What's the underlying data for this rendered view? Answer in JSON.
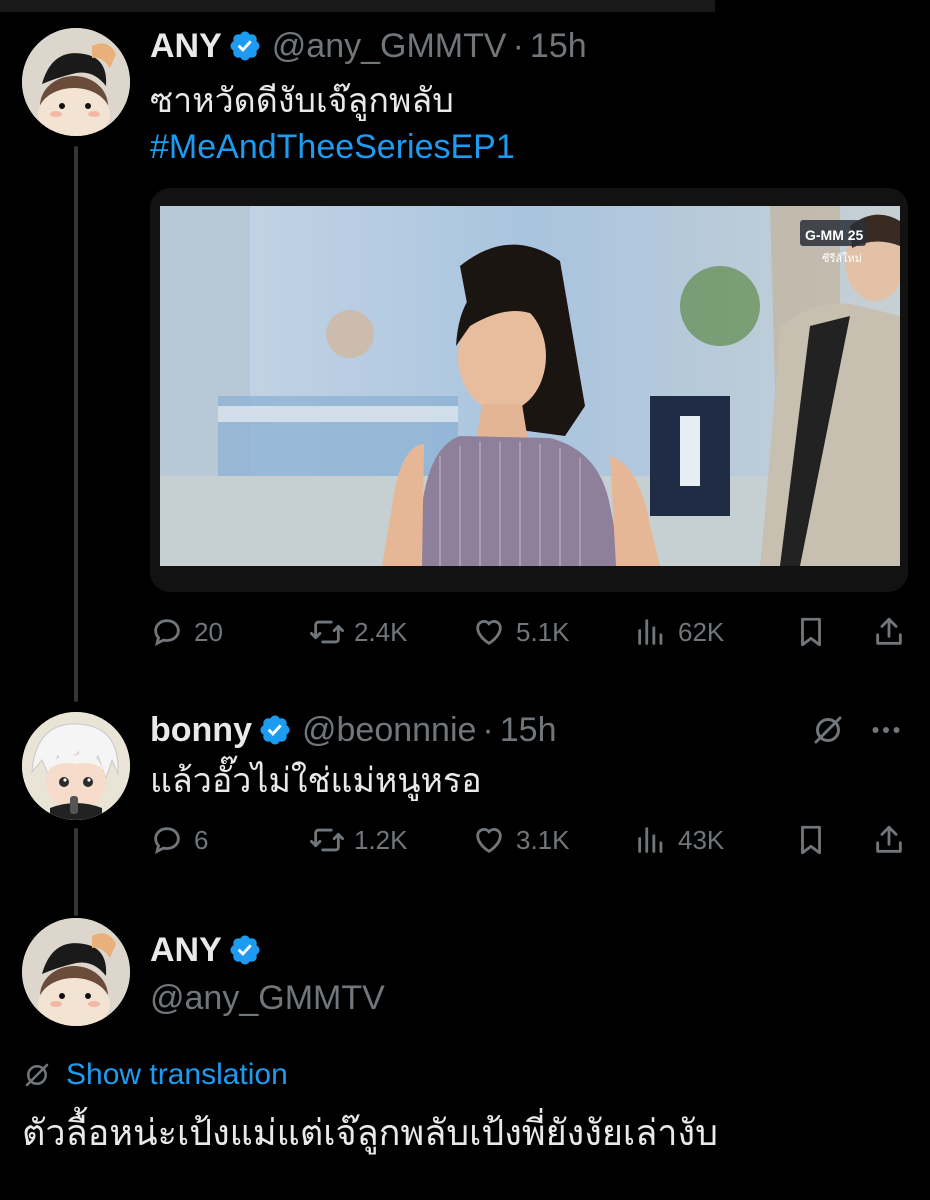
{
  "tweets": [
    {
      "name": "ANY",
      "handle": "@any_GMMTV",
      "sep": "·",
      "time": "15h",
      "text": "ซาหวัดดีงับเจ๊ลูกพลับ",
      "hashtag": "#MeAndTheeSeriesEP1",
      "media": {
        "logo": "G-MM 25",
        "logo_sub": "ซีรีส์ใหม่"
      },
      "stats": {
        "replies": "20",
        "reposts": "2.4K",
        "likes": "5.1K",
        "views": "62K"
      }
    },
    {
      "name": "bonny",
      "handle": "@beonnnie",
      "sep": "·",
      "time": "15h",
      "text": "แล้วอั๊วไม่ใช่แม่หนูหรอ",
      "stats": {
        "replies": "6",
        "reposts": "1.2K",
        "likes": "3.1K",
        "views": "43K"
      }
    },
    {
      "name": "ANY",
      "handle": "@any_GMMTV",
      "show_translation": "Show translation",
      "text": "ตัวลื้อหน่ะเป้งแม่แต่เจ๊ลูกพลับเป้งพี่ยังงัยเล่างับ"
    }
  ],
  "colors": {
    "background": "#000000",
    "accent": "#1d9bf0",
    "muted": "#71767b",
    "text": "#e7e9ea"
  },
  "icons": [
    "reply-icon",
    "repost-icon",
    "like-icon",
    "views-icon",
    "bookmark-icon",
    "share-icon",
    "verified-badge-icon",
    "grok-icon",
    "more-icon",
    "translate-icon"
  ]
}
